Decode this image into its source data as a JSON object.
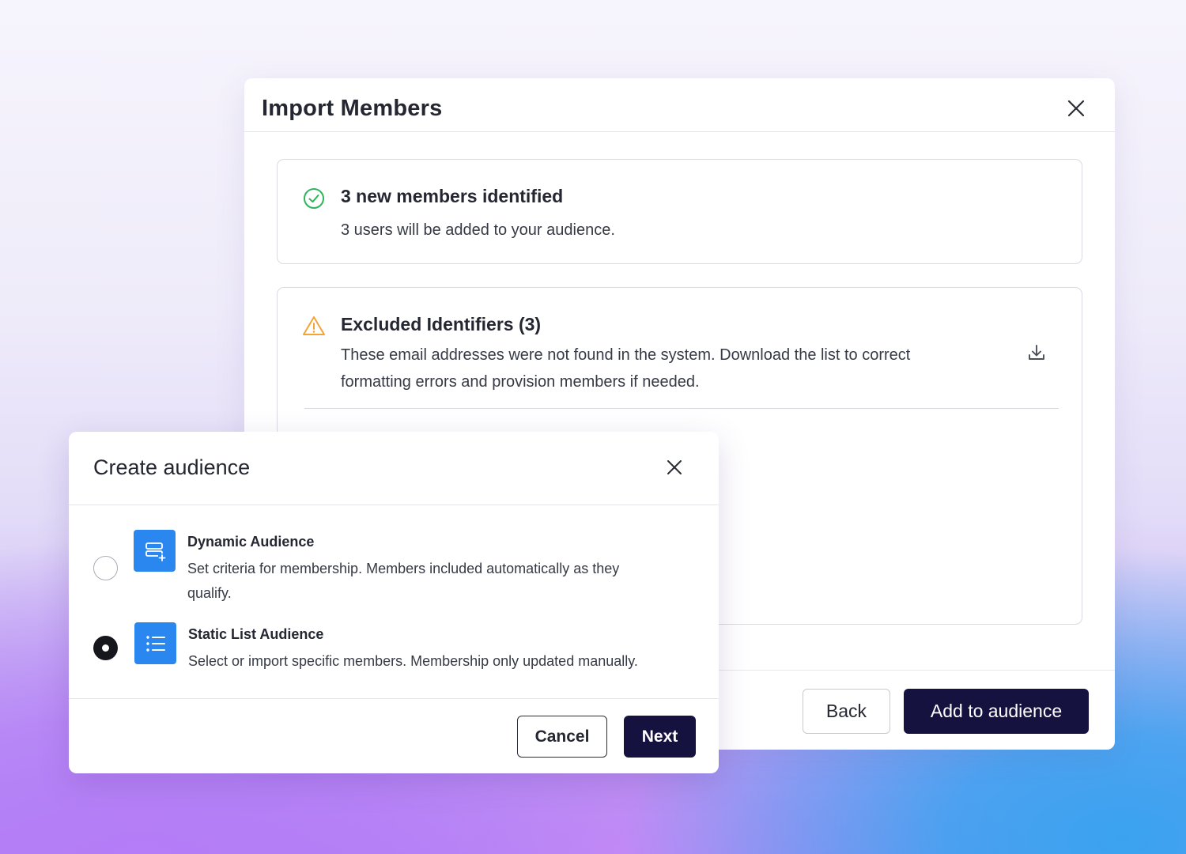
{
  "import_modal": {
    "title": "Import Members",
    "close_icon": "close-icon",
    "success_card": {
      "icon": "check-circle-icon",
      "icon_color": "#2fb65a",
      "title": "3 new members identified",
      "text": "3 users will be added to your audience."
    },
    "excluded_card": {
      "icon": "warning-triangle-icon",
      "icon_color": "#f2a43a",
      "title": "Excluded Identifiers (3)",
      "text_line1": "These email addresses were not found in the system. Download the list to correct",
      "text_line2": "formatting errors and provision members if needed.",
      "download_icon": "download-icon"
    },
    "footer": {
      "back_label": "Back",
      "add_label": "Add to audience"
    }
  },
  "audience_modal": {
    "title": "Create audience",
    "close_icon": "close-icon",
    "options": [
      {
        "icon": "dynamic-audience-icon",
        "title": "Dynamic Audience",
        "desc_line1": "Set criteria for membership. Members included automatically as they",
        "desc_line2": "qualify.",
        "selected": false
      },
      {
        "icon": "list-icon",
        "title": "Static List Audience",
        "desc_line1": "Select or import specific members. Membership only updated manually.",
        "selected": true
      }
    ],
    "footer": {
      "cancel_label": "Cancel",
      "next_label": "Next"
    }
  },
  "colors": {
    "primary_dark": "#15123f",
    "accent_blue": "#2b87f0",
    "success_green": "#2fb65a",
    "warning_orange": "#f2a43a"
  }
}
